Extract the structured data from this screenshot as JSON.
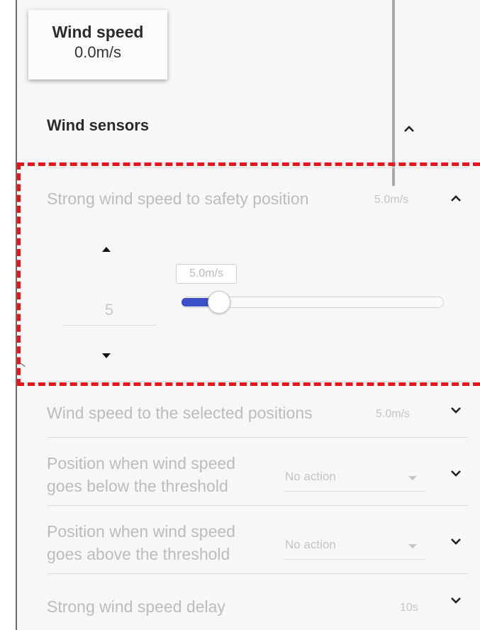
{
  "card": {
    "title": "Wind speed",
    "value": "0.0m/s"
  },
  "section": {
    "title": "Wind sensors"
  },
  "strong_wind": {
    "label": "Strong wind speed to safety position",
    "value": "5.0m/s",
    "stepper_value": "5",
    "slider_tooltip": "5.0m/s",
    "slider_fraction": 0.14
  },
  "rows": {
    "selected_positions": {
      "label": "Wind speed to the selected positions",
      "value": "5.0m/s"
    },
    "below_threshold": {
      "label_line1": "Position when wind speed",
      "label_line2": "goes below the threshold",
      "select_value": "No action"
    },
    "above_threshold": {
      "label_line1": "Position when wind speed",
      "label_line2": "goes above the threshold",
      "select_value": "No action"
    },
    "delay": {
      "label": "Strong wind speed delay",
      "value": "10s"
    }
  },
  "colors": {
    "highlight_dash": "#e8141a",
    "slider_fill": "#3b4fc6",
    "disabled_text": "#bcbcbc"
  },
  "icons": {
    "expand": "chevron-down-icon",
    "collapse": "chevron-up-icon",
    "increment": "triangle-up-icon",
    "decrement": "triangle-down-icon",
    "dropdown": "caret-down-icon"
  }
}
